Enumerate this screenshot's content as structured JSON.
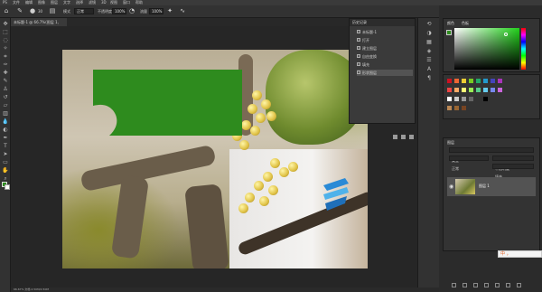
{
  "menubar": {
    "items": [
      "PS",
      "文件",
      "编辑",
      "图像",
      "图层",
      "文字",
      "选择",
      "滤镜",
      "3D",
      "视图",
      "窗口",
      "帮助"
    ]
  },
  "options": {
    "brush_size": "30",
    "mode_label": "模式",
    "mode_value": "正常",
    "opacity_label": "不透明度",
    "opacity_value": "100%",
    "flow_label": "流量",
    "flow_value": "100%"
  },
  "document": {
    "tab_title": "未标题-1 @ 66.7%(图层 1, RGB/8)",
    "status": "66.67%   文档:2.50M/2.50M"
  },
  "navigator": {
    "title": "历史记录",
    "items": [
      {
        "label": "未标题-1"
      },
      {
        "label": "打开"
      },
      {
        "label": "建立图层"
      },
      {
        "label": "自由变换"
      },
      {
        "label": "填充"
      },
      {
        "label": "形状图层"
      }
    ]
  },
  "color_panel": {
    "tab1": "颜色",
    "tab2": "色板",
    "foreground": "#2e8b1e",
    "picked": "#22d21b"
  },
  "layers_panel": {
    "tab": "图层",
    "layer_name": "图层 1",
    "kind_label": "类型",
    "blend_label": "正常",
    "opacity_label": "不透明度",
    "fill_label": "填充"
  },
  "callout": {
    "color": "#2e8b1e"
  },
  "ime": {
    "label": "中 ，"
  }
}
